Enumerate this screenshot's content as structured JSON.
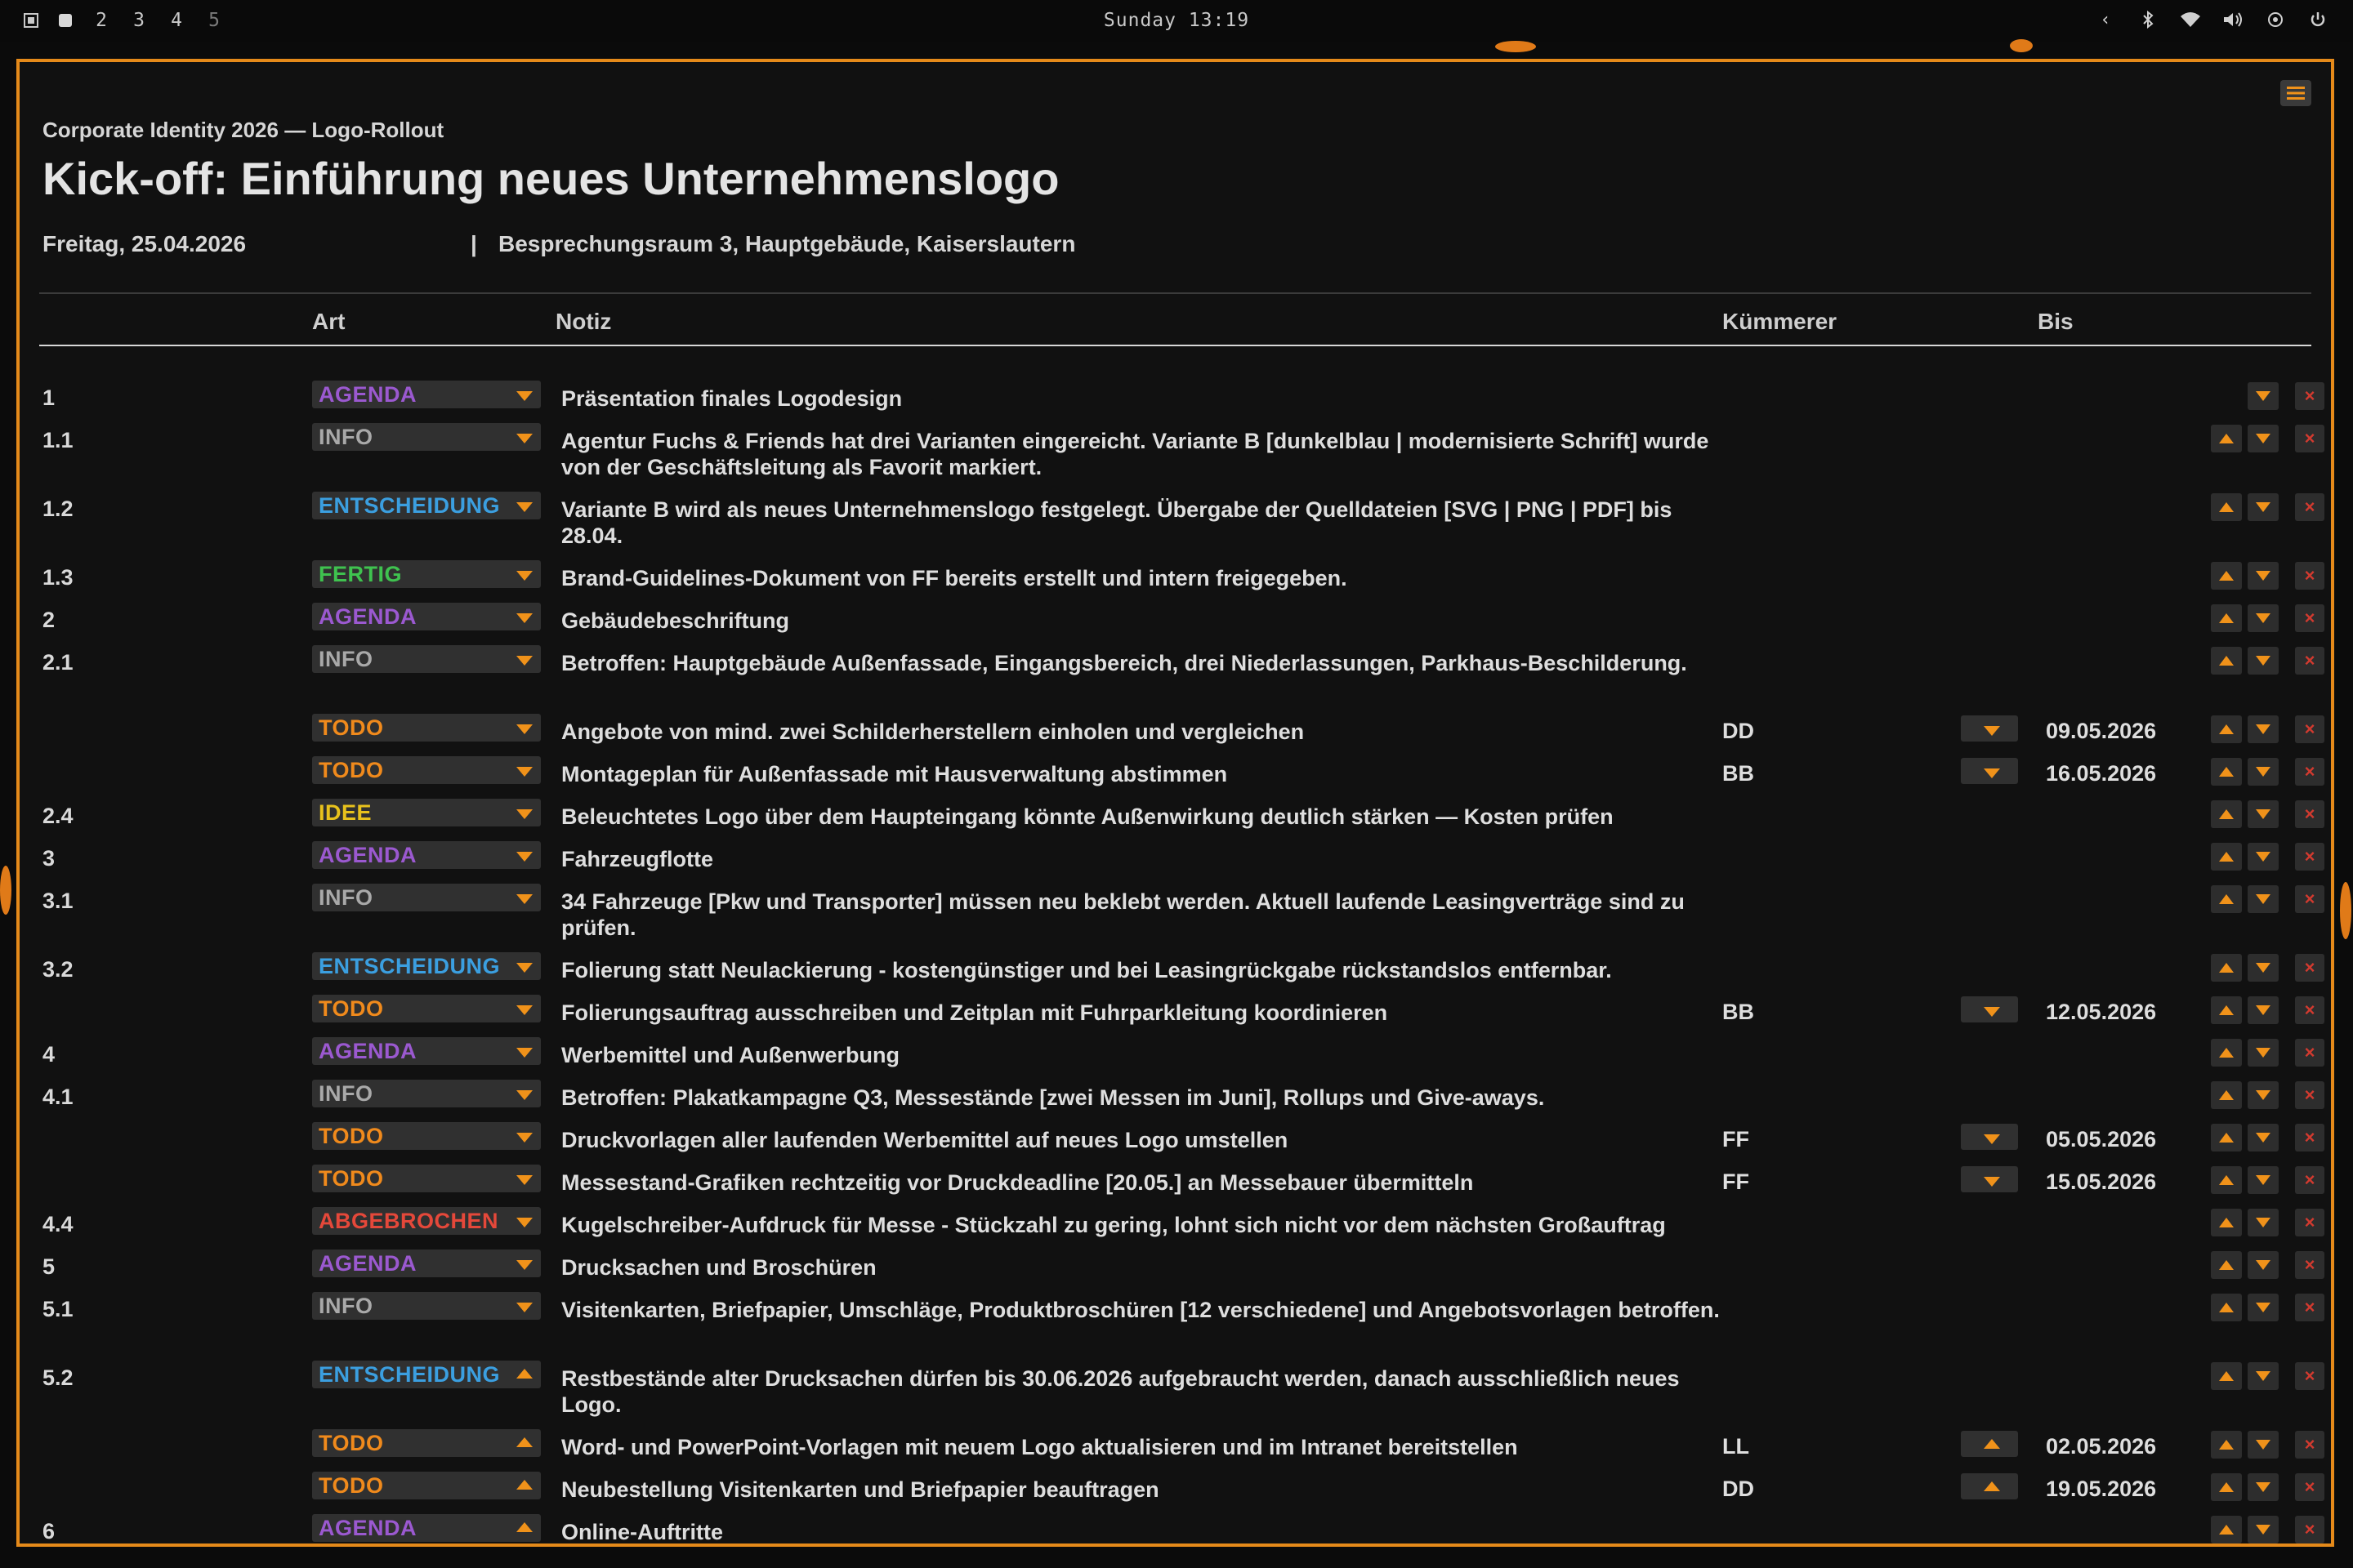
{
  "topbar": {
    "workspaces": [
      "2",
      "3",
      "4",
      "5"
    ],
    "clock": "Sunday 13:19",
    "tray_icons": [
      "chevron-left-icon",
      "bluetooth-icon",
      "wifi-icon",
      "volume-icon",
      "network-icon",
      "power-icon"
    ]
  },
  "window": {
    "menu_icon": "menu-icon",
    "project": "Corporate Identity 2026 — Logo-Rollout",
    "title": "Kick-off: Einführung neues Unternehmenslogo",
    "date": "Freitag, 25.04.2026",
    "separator": "|",
    "location": "Besprechungsraum 3, Hauptgebäude, Kaiserslautern"
  },
  "columns": {
    "art": "Art",
    "notiz": "Notiz",
    "kuemmerer": "Kümmerer",
    "bis": "Bis"
  },
  "colors": {
    "AGENDA": "#9b59d0",
    "INFO": "#a9a9a9",
    "ENTSCHEIDUNG": "#3b9fe0",
    "FERTIG": "#3fc24f",
    "TODO": "#f08a1c",
    "IDEE": "#e8c21c",
    "ABGEBROCHEN": "#e5483a",
    "accent": "#e58a1a"
  },
  "rows": [
    {
      "num": "1",
      "type": "AGENDA",
      "note": "Präsentation finales Logodesign",
      "owner": "",
      "due": "",
      "arrow": "down",
      "up": false
    },
    {
      "num": "1.1",
      "type": "INFO",
      "note": "Agentur Fuchs & Friends hat drei Varianten eingereicht. Variante B [dunkelblau | modernisierte Schrift] wurde von der Geschäftsleitung als Favorit markiert.",
      "owner": "",
      "due": "",
      "arrow": "down",
      "up": true
    },
    {
      "num": "1.2",
      "type": "ENTSCHEIDUNG",
      "note": "Variante B wird als neues Unternehmenslogo festgelegt. Übergabe der Quelldateien [SVG | PNG | PDF] bis 28.04.",
      "owner": "",
      "due": "",
      "arrow": "down",
      "up": true
    },
    {
      "num": "1.3",
      "type": "FERTIG",
      "note": "Brand-Guidelines-Dokument von FF bereits erstellt und intern freigegeben.",
      "owner": "",
      "due": "",
      "arrow": "down",
      "up": true
    },
    {
      "num": "2",
      "type": "AGENDA",
      "note": "Gebäudebeschriftung",
      "owner": "",
      "due": "",
      "arrow": "down",
      "up": true
    },
    {
      "num": "2.1",
      "type": "INFO",
      "note": "Betroffen: Hauptgebäude Außenfassade, Eingangsbereich, drei Niederlassungen, Parkhaus-Beschilderung.",
      "owner": "",
      "due": "",
      "arrow": "down",
      "up": true
    },
    {
      "num": "",
      "type": "TODO",
      "note": "Angebote von mind. zwei Schilderherstellern einholen und vergleichen",
      "owner": "DD",
      "due": "09.05.2026",
      "arrow": "down",
      "up": true
    },
    {
      "num": "",
      "type": "TODO",
      "note": "Montageplan für Außenfassade mit Hausverwaltung abstimmen",
      "owner": "BB",
      "due": "16.05.2026",
      "arrow": "down",
      "up": true
    },
    {
      "num": "2.4",
      "type": "IDEE",
      "note": "Beleuchtetes Logo über dem Haupteingang könnte Außenwirkung deutlich stärken — Kosten prüfen",
      "owner": "",
      "due": "",
      "arrow": "down",
      "up": true
    },
    {
      "num": "3",
      "type": "AGENDA",
      "note": "Fahrzeugflotte",
      "owner": "",
      "due": "",
      "arrow": "down",
      "up": true
    },
    {
      "num": "3.1",
      "type": "INFO",
      "note": "34 Fahrzeuge [Pkw und Transporter] müssen neu beklebt werden. Aktuell laufende Leasingverträge sind zu prüfen.",
      "owner": "",
      "due": "",
      "arrow": "down",
      "up": true
    },
    {
      "num": "3.2",
      "type": "ENTSCHEIDUNG",
      "note": "Folierung statt Neulackierung - kostengünstiger und bei Leasingrückgabe rückstandslos entfernbar.",
      "owner": "",
      "due": "",
      "arrow": "down",
      "up": true
    },
    {
      "num": "",
      "type": "TODO",
      "note": "Folierungsauftrag ausschreiben und Zeitplan mit Fuhrparkleitung koordinieren",
      "owner": "BB",
      "due": "12.05.2026",
      "arrow": "down",
      "up": true
    },
    {
      "num": "4",
      "type": "AGENDA",
      "note": "Werbemittel und Außenwerbung",
      "owner": "",
      "due": "",
      "arrow": "down",
      "up": true
    },
    {
      "num": "4.1",
      "type": "INFO",
      "note": "Betroffen: Plakatkampagne Q3, Messestände [zwei Messen im Juni], Rollups und Give-aways.",
      "owner": "",
      "due": "",
      "arrow": "down",
      "up": true
    },
    {
      "num": "",
      "type": "TODO",
      "note": "Druckvorlagen aller laufenden Werbemittel auf neues Logo umstellen",
      "owner": "FF",
      "due": "05.05.2026",
      "arrow": "down",
      "up": true
    },
    {
      "num": "",
      "type": "TODO",
      "note": "Messestand-Grafiken rechtzeitig vor Druckdeadline [20.05.] an Messebauer übermitteln",
      "owner": "FF",
      "due": "15.05.2026",
      "arrow": "down",
      "up": true
    },
    {
      "num": "4.4",
      "type": "ABGEBROCHEN",
      "note": "Kugelschreiber-Aufdruck für Messe - Stückzahl zu gering, lohnt sich nicht vor dem nächsten Großauftrag",
      "owner": "",
      "due": "",
      "arrow": "down",
      "up": true
    },
    {
      "num": "5",
      "type": "AGENDA",
      "note": "Drucksachen und Broschüren",
      "owner": "",
      "due": "",
      "arrow": "down",
      "up": true
    },
    {
      "num": "5.1",
      "type": "INFO",
      "note": "Visitenkarten, Briefpapier, Umschläge, Produktbroschüren [12 verschiedene] und Angebotsvorlagen betroffen.",
      "owner": "",
      "due": "",
      "arrow": "down",
      "up": true
    },
    {
      "num": "5.2",
      "type": "ENTSCHEIDUNG",
      "note": "Restbestände alter Drucksachen dürfen bis 30.06.2026 aufgebraucht werden, danach ausschließlich neues Logo.",
      "owner": "",
      "due": "",
      "arrow": "up",
      "up": true
    },
    {
      "num": "",
      "type": "TODO",
      "note": "Word- und PowerPoint-Vorlagen mit neuem Logo aktualisieren und im Intranet bereitstellen",
      "owner": "LL",
      "due": "02.05.2026",
      "arrow": "up",
      "up": true
    },
    {
      "num": "",
      "type": "TODO",
      "note": "Neubestellung Visitenkarten und Briefpapier beauftragen",
      "owner": "DD",
      "due": "19.05.2026",
      "arrow": "up",
      "up": true
    },
    {
      "num": "6",
      "type": "AGENDA",
      "note": "Online-Auftritte",
      "owner": "",
      "due": "",
      "arrow": "up",
      "up": true
    }
  ]
}
